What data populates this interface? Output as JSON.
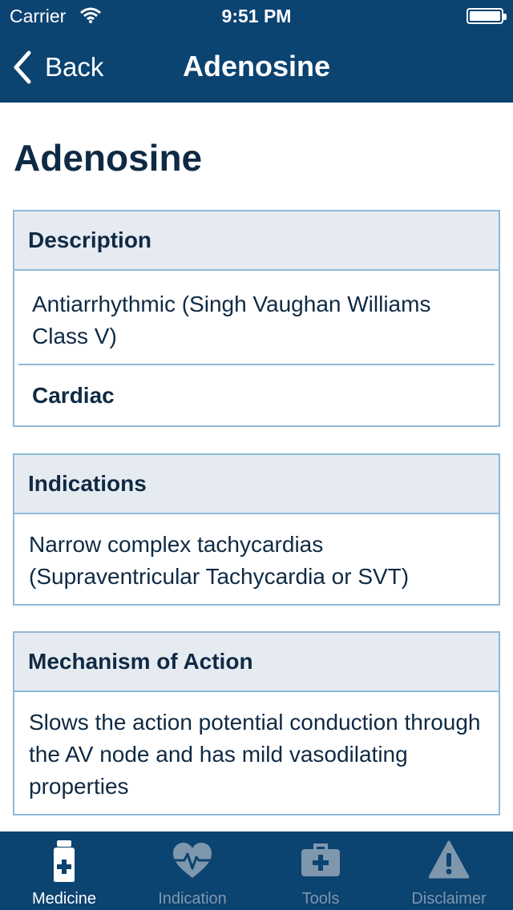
{
  "status_bar": {
    "carrier": "Carrier",
    "time": "9:51 PM"
  },
  "nav": {
    "back_label": "Back",
    "title": "Adenosine"
  },
  "page": {
    "title": "Adenosine"
  },
  "description_card": {
    "header": "Description",
    "text": "Antiarrhythmic (Singh Vaughan Williams Class V)",
    "category": "Cardiac"
  },
  "indications_card": {
    "header": "Indications",
    "text": "Narrow complex tachycardias (Supraventricular Tachycardia or SVT)"
  },
  "mechanism_card": {
    "header": "Mechanism of Action",
    "text": "Slows the action potential conduction through the AV node and has mild vasodilating properties"
  },
  "tabs": [
    {
      "label": "Medicine",
      "icon": "medicine-bottle-icon",
      "active": true
    },
    {
      "label": "Indication",
      "icon": "heart-pulse-icon",
      "active": false
    },
    {
      "label": "Tools",
      "icon": "toolbox-icon",
      "active": false
    },
    {
      "label": "Disclaimer",
      "icon": "warning-icon",
      "active": false
    }
  ],
  "colors": {
    "nav_background": "#0b4371",
    "text_dark": "#0f2a44",
    "card_border": "#8fb9d9",
    "card_header_bg": "#e6ebf1",
    "tab_inactive": "#7f97ad",
    "tab_active": "#ffffff"
  }
}
